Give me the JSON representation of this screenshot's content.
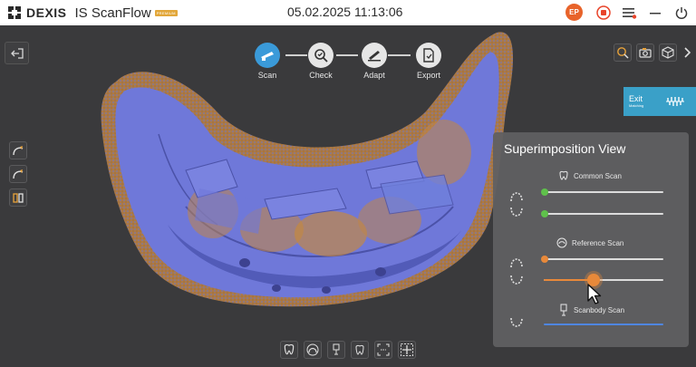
{
  "titlebar": {
    "brand": "DEXIS",
    "app_name": "IS ScanFlow",
    "badge": "PREMIUM",
    "datetime": "05.02.2025 11:13:06",
    "user_initials": "EP"
  },
  "workflow": {
    "steps": [
      {
        "label": "Scan",
        "active": true
      },
      {
        "label": "Check",
        "active": false
      },
      {
        "label": "Adapt",
        "active": false
      },
      {
        "label": "Export",
        "active": false
      }
    ]
  },
  "exit_matching": {
    "label": "Exit",
    "sublabel": "Matching"
  },
  "superimposition": {
    "title": "Superimposition View",
    "sections": [
      {
        "label": "Common Scan",
        "color": "#5fc14b",
        "slider_values": [
          0.0,
          0.0
        ]
      },
      {
        "label": "Reference Scan",
        "color": "#e8893a",
        "slider_values": [
          0.0,
          0.42
        ]
      },
      {
        "label": "Scanbody Scan",
        "color": "#4f86e0",
        "slider_values": [
          1.0
        ]
      }
    ]
  },
  "colors": {
    "accent_blue": "#3a9ad9",
    "scan_blue": "#6f78d9",
    "scan_orange": "#c08548",
    "user_avatar": "#e8632a",
    "record_red": "#e8442a"
  }
}
